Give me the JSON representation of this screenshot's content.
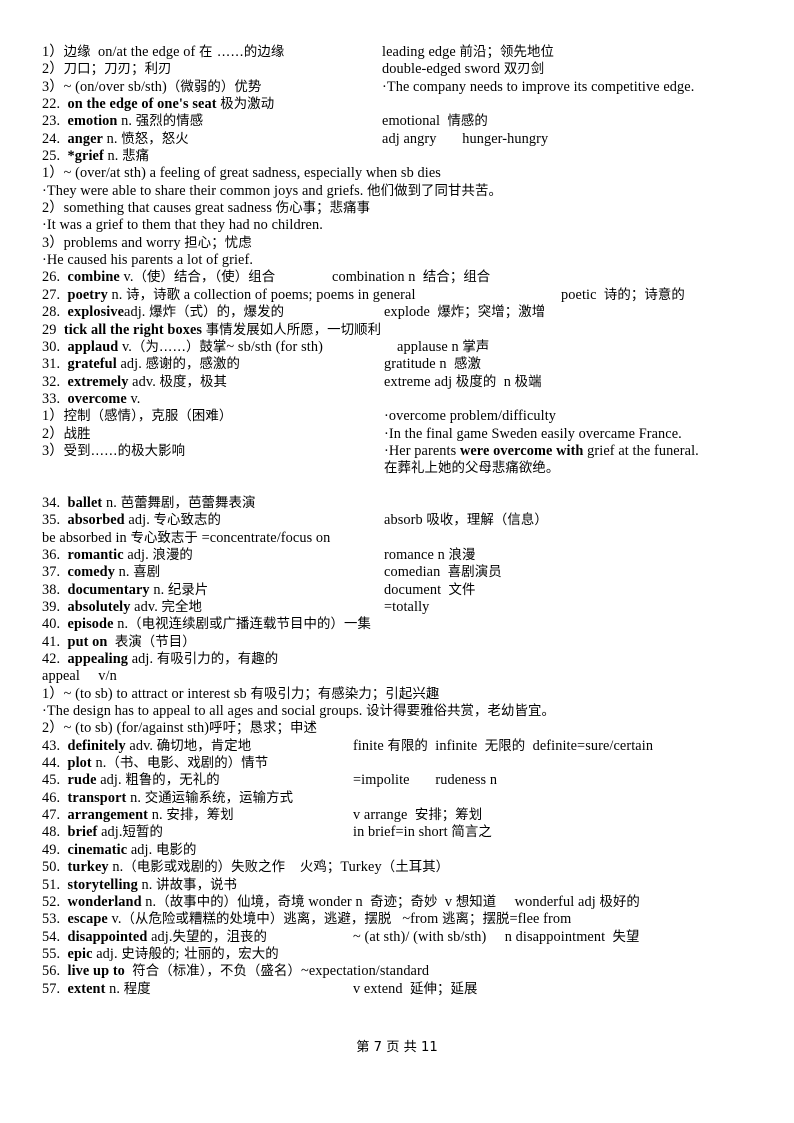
{
  "document": {
    "page_footer": "第 7 页 共 11",
    "lines": [
      {
        "left": "1）边缘  on/at the edge of 在 ……的边缘",
        "right": "leading edge 前沿；领先地位"
      },
      {
        "left": "2）刀口；刀刃；利刃",
        "right": "double-edged sword 双刃剑"
      },
      {
        "left": "3）~ (on/over sb/sth)（微弱的）优势",
        "right": "·The company needs to improve its competitive edge."
      },
      {
        "left": "22.  on the edge of one's seat 极为激动",
        "right": ""
      },
      {
        "left": "23.  emotion n. 强烈的情感",
        "right": "emotional  情感的"
      },
      {
        "left": "24.  anger n. 愤怒，怒火",
        "right": "adj angry      hunger-hungry"
      },
      {
        "left": "25.  *grief n. 悲痛",
        "right": ""
      },
      {
        "left": "1）~ (over/at sth) a feeling of great sadness, especially when sb dies",
        "right": ""
      },
      {
        "left": "·They were able to share their common joys and griefs. 他们做到了同甘共苦。",
        "right": ""
      },
      {
        "left": "2）something that causes great sadness 伤心事；悲痛事",
        "right": ""
      },
      {
        "left": "·It was a grief to them that they had no children.",
        "right": ""
      },
      {
        "left": "3）problems and worry 担心；忧虑",
        "right": ""
      },
      {
        "left": "·He caused his parents a lot of grief.",
        "right": ""
      },
      {
        "left": "26.  combine v.（使）结合，（使）组合",
        "right": "combination n  结合；组合"
      },
      {
        "left": "27.  poetry n. 诗，诗歌 a collection of poems; poems in general",
        "right": "poetic  诗的；诗意的"
      },
      {
        "left": "28.  explosive adj. 爆炸（式）的，爆发的",
        "right": "explode  爆炸；突增；激增"
      },
      {
        "left": "29  tick all the right boxes 事情发展如人所愿，一切顺利",
        "right": ""
      },
      {
        "left": "30.  applaud v.（为……）鼓掌~ sb/sth (for sth)",
        "right": "applause n 掌声"
      },
      {
        "left": "31.  grateful adj. 感谢的，感激的",
        "right": "gratitude n  感激"
      },
      {
        "left": "32.  extremely adv. 极度，极其",
        "right": "extreme adj 极度的  n 极端"
      },
      {
        "left": "33.  overcome v.",
        "right": ""
      },
      {
        "left": "1）控制（感情），克服（困难）",
        "right": "·overcome problem/difficulty"
      },
      {
        "left": "2）战胜",
        "right": "·In the final game Sweden easily overcame France."
      },
      {
        "left": "3）受到……的极大影响",
        "right": "·Her parents were overcome with grief at the funeral."
      },
      {
        "left": "",
        "right": "在葬礼上她的父母悲痛欲绝。"
      },
      {
        "left": "34.  ballet n. 芭蕾舞剧，芭蕾舞表演",
        "right": ""
      },
      {
        "left": "35.  absorbed adj. 专心致志的",
        "right": "absorb 吸收，理解（信息）"
      },
      {
        "left": "be absorbed in 专心致志于 =concentrate/focus on",
        "right": ""
      },
      {
        "left": "36.  romantic adj. 浪漫的",
        "right": "romance n 浪漫"
      },
      {
        "left": "37.  comedy n. 喜剧",
        "right": "comedian  喜剧演员"
      },
      {
        "left": "38.  documentary n. 纪录片",
        "right": "document  文件"
      },
      {
        "left": "39.  absolutely adv. 完全地",
        "right": "=totally"
      },
      {
        "left": "40.  episode n.（电视连续剧或广播连载节目中的）一集",
        "right": ""
      },
      {
        "left": "41.  put on  表演（节目）",
        "right": ""
      },
      {
        "left": "42.  appealing adj. 有吸引力的，有趣的",
        "right": ""
      },
      {
        "left": "appeal    v/n",
        "right": ""
      },
      {
        "left": "1）~ (to sb) to attract or interest sb 有吸引力；有感染力；引起兴趣",
        "right": ""
      },
      {
        "left": "·The design has to appeal to all ages and social groups. 设计得要雅俗共赏，老幼皆宜。",
        "right": ""
      },
      {
        "left": "2）~ (to sb) (for/against sth)呼吁；恳求；申述",
        "right": ""
      },
      {
        "left": "43.  definitely adv. 确切地，肯定地",
        "right": "finite 有限的  infinite  无限的  definite=sure/certain"
      },
      {
        "left": "44.  plot n.（书、电影、戏剧的）情节",
        "right": ""
      },
      {
        "left": "45.  rude adj. 粗鲁的，无礼的",
        "right": "=impolite      rudeness n"
      },
      {
        "left": "46.  transport n. 交通运输系统，运输方式",
        "right": ""
      },
      {
        "left": "47.  arrangement n. 安排，筹划",
        "right": "v arrange  安排；筹划"
      },
      {
        "left": "48.  brief adj. 短暂的",
        "right": "in brief=in short 简言之"
      },
      {
        "left": "49.  cinematic adj. 电影的",
        "right": ""
      },
      {
        "left": "50.  turkey n.（电影或戏剧的）失败之作    火鸡；Turkey（土耳其）",
        "right": ""
      },
      {
        "left": "51.  storytelling n. 讲故事，说书",
        "right": ""
      },
      {
        "left": "52.  wonderland n.（故事中的）仙境，奇境 wonder n  奇迹；奇妙  v 想知道      wonderful adj 极好的",
        "right": ""
      },
      {
        "left": "53.  escape v.（从危险或糟糕的处境中）逃离，逃避，摆脱   ~from 逃离；摆脱=flee from",
        "right": ""
      },
      {
        "left": "54.  disappointed adj. 失望的，沮丧的",
        "right": "~ (at sth)/ (with sb/sth)     n disappointment  失望"
      },
      {
        "left": "55.  epic adj. 史诗般的; 壮丽的，宏大的",
        "right": ""
      },
      {
        "left": "56.  live up to  符合（标准），不负（盛名）~expectation/standard",
        "right": ""
      },
      {
        "left": "57.  extent n. 程度",
        "right": "v extend  延伸；延展"
      }
    ]
  }
}
